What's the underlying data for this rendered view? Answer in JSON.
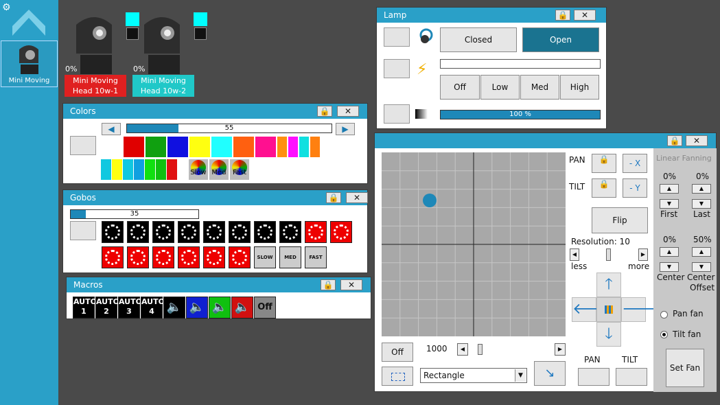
{
  "fixtures": [
    {
      "percent": "0%",
      "name_line1": "Mini Moving",
      "name_line2": "Head 10w-1",
      "color": "#e02020"
    },
    {
      "percent": "0%",
      "name_line1": "Mini Moving",
      "name_line2": "Head 10w-2",
      "color": "#20c8c8"
    }
  ],
  "sidebar": {
    "selected_label": "Mini Moving",
    "settings_icon": "gear-icon",
    "up_icon": "chevron-up-icon"
  },
  "colors_panel": {
    "title": "Colors",
    "lock": "lock-icon",
    "close": "✕",
    "slider_value": "55",
    "slider_fraction": 0.25,
    "row1": [
      "#e00000",
      "#10a010",
      "#1010e0",
      "#ffff10",
      "#20ffff",
      "#ff6010",
      "#ff1090",
      "#ff9010",
      "#ff10ff",
      "#10e0e0",
      "#ff8010"
    ],
    "row2": [
      "#10c8e0",
      "#ffff10",
      "#10c8e0",
      "#10a0e0",
      "#10e010",
      "#10c010",
      "#e01010"
    ],
    "speed": [
      "Slow",
      "Med",
      "Fast"
    ]
  },
  "gobos_panel": {
    "title": "Gobos",
    "slider_value": "35",
    "slider_fraction": 0.12,
    "speed": [
      "SLOW",
      "MED",
      "FAST"
    ]
  },
  "macros_panel": {
    "title": "Macros",
    "auto": [
      {
        "top": "AUTO",
        "num": "1"
      },
      {
        "top": "AUTO",
        "num": "2"
      },
      {
        "top": "AUTO",
        "num": "3"
      },
      {
        "top": "AUTO",
        "num": "4"
      }
    ],
    "off": "Off"
  },
  "lamp_panel": {
    "title": "Lamp",
    "closed": "Closed",
    "open": "Open",
    "off": "Off",
    "low": "Low",
    "med": "Med",
    "high": "High",
    "dimmer": "100 %",
    "dimmer_fraction": 1.0
  },
  "pantilt_panel": {
    "pan": "PAN",
    "tilt": "TILT",
    "neg_x": "- X",
    "neg_y": "- Y",
    "flip": "Flip",
    "resolution": "Resolution: 10",
    "less": "less",
    "more": "more",
    "off": "Off",
    "speed_value": "1000",
    "shape": "Rectangle",
    "pan_label": "PAN",
    "tilt_label": "TILT",
    "linear_fanning": "Linear Fanning",
    "first_pct": "0%",
    "last_pct": "0%",
    "first": "First",
    "last": "Last",
    "center_pct": "0%",
    "offset_pct": "50%",
    "center": "Center",
    "center_offset_1": "Center",
    "center_offset_2": "Offset",
    "pan_fan": "Pan fan",
    "tilt_fan": "Tilt fan",
    "set_fan": "Set Fan"
  }
}
